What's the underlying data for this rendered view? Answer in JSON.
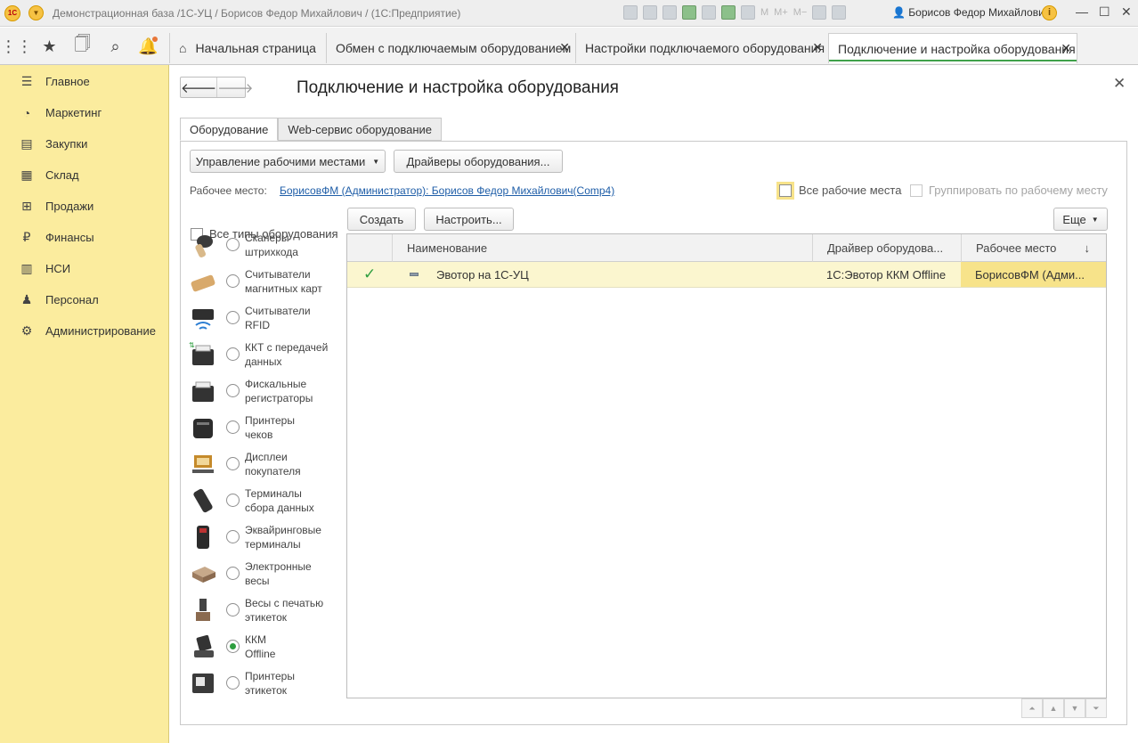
{
  "titlebar": {
    "logo": "1С",
    "title": "Демонстрационная база /1С-УЦ / Борисов Федор Михайлович /  (1С:Предприятие)",
    "tools": [
      "M",
      "M+",
      "M−"
    ],
    "user": "Борисов Федор Михайлович",
    "info_label": "i"
  },
  "nav": {
    "icons": [
      "apps-grid-icon",
      "star-icon",
      "history-icon",
      "search-icon",
      "bell-icon"
    ]
  },
  "tabs": [
    {
      "label": "Начальная страница"
    },
    {
      "label": "Обмен с подключаемым оборудованием"
    },
    {
      "label": "Настройки подключаемого оборудования"
    },
    {
      "label": "Подключение и настройка оборудования"
    }
  ],
  "sidebar": {
    "items": [
      {
        "label": "Главное",
        "icon": "menu-lines-icon"
      },
      {
        "label": "Маркетинг",
        "icon": "pie-chart-icon"
      },
      {
        "label": "Закупки",
        "icon": "purchases-icon"
      },
      {
        "label": "Склад",
        "icon": "warehouse-icon"
      },
      {
        "label": "Продажи",
        "icon": "basket-icon"
      },
      {
        "label": "Финансы",
        "icon": "ruble-icon"
      },
      {
        "label": "НСИ",
        "icon": "book-icon"
      },
      {
        "label": "Персонал",
        "icon": "person-icon"
      },
      {
        "label": "Администрирование",
        "icon": "gear-icon"
      }
    ]
  },
  "page": {
    "title": "Подключение и настройка оборудования",
    "tabs": [
      "Оборудование",
      "Web-сервис оборудование"
    ],
    "manage_workplaces": "Управление рабочими местами",
    "drivers": "Драйверы оборудования...",
    "workplace_label": "Рабочее место:",
    "workplace_value": "БорисовФМ (Администратор): Борисов Федор Михайлович(Comp4)",
    "all_workplaces": "Все рабочие места",
    "group_by_workplace": "Группировать по рабочему месту",
    "create": "Создать",
    "configure": "Настроить...",
    "more": "Еще",
    "all_types": "Все типы оборудования"
  },
  "equipment_types": [
    {
      "label": "Сканеры\nштрихкода",
      "icon": "barcode-scanner-icon",
      "selected": false
    },
    {
      "label": "Считыватели\nмагнитных карт",
      "icon": "card-reader-icon",
      "selected": false
    },
    {
      "label": "Считыватели\nRFID",
      "icon": "rfid-reader-icon",
      "selected": false
    },
    {
      "label": "ККТ с передачей\nданных",
      "icon": "kkt-icon",
      "selected": false
    },
    {
      "label": "Фискальные\nрегистраторы",
      "icon": "fiscal-registrar-icon",
      "selected": false
    },
    {
      "label": "Принтеры\nчеков",
      "icon": "receipt-printer-icon",
      "selected": false
    },
    {
      "label": "Дисплеи\nпокупателя",
      "icon": "customer-display-icon",
      "selected": false
    },
    {
      "label": "Терминалы\nсбора данных",
      "icon": "data-terminal-icon",
      "selected": false
    },
    {
      "label": "Эквайринговые\nтерминалы",
      "icon": "pos-terminal-icon",
      "selected": false
    },
    {
      "label": "Электронные\nвесы",
      "icon": "scales-icon",
      "selected": false
    },
    {
      "label": "Весы с печатью\nэтикеток",
      "icon": "label-scales-icon",
      "selected": false
    },
    {
      "label": "ККМ\nOffline",
      "icon": "kkm-offline-icon",
      "selected": true
    },
    {
      "label": "Принтеры\nэтикеток",
      "icon": "label-printer-icon",
      "selected": false
    }
  ],
  "table": {
    "columns": [
      "Наименование",
      "Драйвер оборудова...",
      "Рабочее место"
    ],
    "rows": [
      {
        "name": "Эвотор на 1С-УЦ",
        "driver": "1С:Эвотор ККМ Offline",
        "workplace": "БорисовФМ (Адми..."
      }
    ]
  },
  "colors": {
    "sidebar_bg": "#fbec9e",
    "accent_green": "#3fa14a",
    "row_highlight": "#fbf6cf",
    "selected_cell": "#f7e38a",
    "link": "#1f5ea8"
  }
}
